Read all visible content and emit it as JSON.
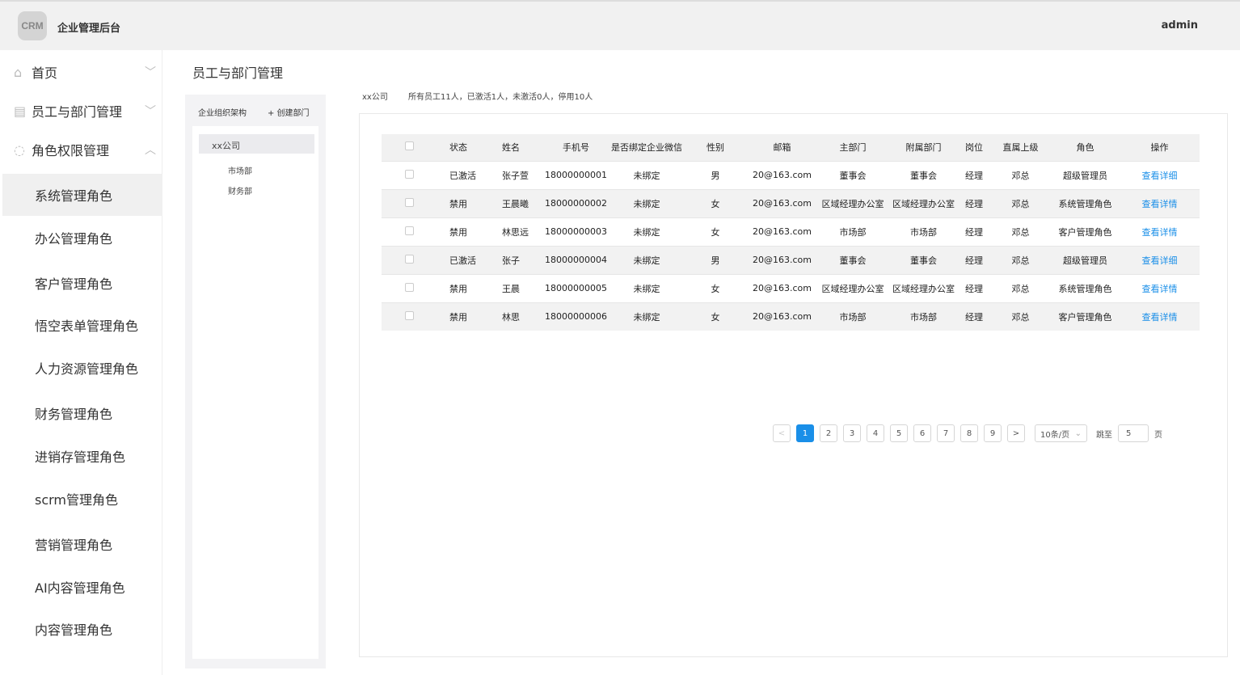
{
  "header": {
    "logo": "CRM",
    "title": "企业管理后台",
    "user": "admin"
  },
  "sidebar": {
    "items": [
      {
        "label": "首页",
        "icon": "home-icon",
        "expanded": false
      },
      {
        "label": "员工与部门管理",
        "icon": "clipboard-icon",
        "expanded": false
      },
      {
        "label": "角色权限管理",
        "icon": "head-icon",
        "expanded": true
      }
    ],
    "subitems": [
      "系统管理角色",
      "办公管理角色",
      "客户管理角色",
      "悟空表单管理角色",
      "人力资源管理角色",
      "财务管理角色",
      "进销存管理角色",
      "scrm管理角色",
      "营销管理角色",
      "AI内容管理角色",
      "内容管理角色"
    ],
    "active_subitem": "系统管理角色"
  },
  "page": {
    "title": "员工与部门管理"
  },
  "tree": {
    "title": "企业组织架构",
    "add_label": "+ 创建部门",
    "root": "xx公司",
    "children": [
      "市场部",
      "财务部"
    ]
  },
  "summary": {
    "company": "xx公司",
    "stats": "所有员工11人，已激活1人，未激活0人，停用10人"
  },
  "table": {
    "headers": [
      "状态",
      "姓名",
      "手机号",
      "是否绑定企业微信",
      "性别",
      "邮箱",
      "主部门",
      "附属部门",
      "岗位",
      "直属上级",
      "角色",
      "操作"
    ],
    "rows": [
      [
        "已激活",
        "张子萱",
        "18000000001",
        "未绑定",
        "男",
        "20@163.com",
        "董事会",
        "董事会",
        "经理",
        "邓总",
        "超级管理员",
        "查看详细"
      ],
      [
        "禁用",
        "王晨曦",
        "18000000002",
        "未绑定",
        "女",
        "20@163.com",
        "区域经理办公室",
        "区域经理办公室",
        "经理",
        "邓总",
        "系统管理角色",
        "查看详情"
      ],
      [
        "禁用",
        "林思远",
        "18000000003",
        "未绑定",
        "女",
        "20@163.com",
        "市场部",
        "市场部",
        "经理",
        "邓总",
        "客户管理角色",
        "查看详情"
      ],
      [
        "已激活",
        "张子",
        "18000000004",
        "未绑定",
        "男",
        "20@163.com",
        "董事会",
        "董事会",
        "经理",
        "邓总",
        "超级管理员",
        "查看详细"
      ],
      [
        "禁用",
        "王晨",
        "18000000005",
        "未绑定",
        "女",
        "20@163.com",
        "区域经理办公室",
        "区域经理办公室",
        "经理",
        "邓总",
        "系统管理角色",
        "查看详情"
      ],
      [
        "禁用",
        "林思",
        "18000000006",
        "未绑定",
        "女",
        "20@163.com",
        "市场部",
        "市场部",
        "经理",
        "邓总",
        "客户管理角色",
        "查看详情"
      ]
    ]
  },
  "pagination": {
    "prev": "<",
    "pages": [
      "1",
      "2",
      "3",
      "4",
      "5",
      "6",
      "7",
      "8",
      "9"
    ],
    "current": "1",
    "next": ">",
    "page_size": "10条/页",
    "jump_label": "跳至",
    "jump_value": "5",
    "page_suffix": "页"
  },
  "colors": {
    "accent": "#1a8fe8",
    "header_bg": "#f1f1f1"
  }
}
